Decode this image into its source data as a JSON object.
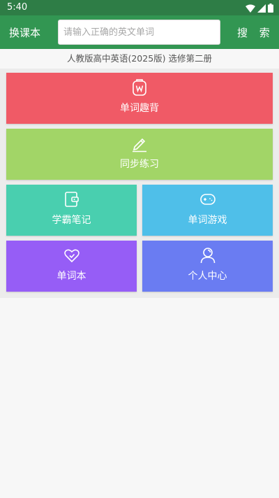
{
  "status_bar": {
    "time": "5:40",
    "icons": [
      "wifi-icon",
      "signal-icon",
      "battery-icon"
    ]
  },
  "app_bar": {
    "change_book_label": "换课本",
    "search_placeholder": "请输入正确的英文单词",
    "search_value": "",
    "search_button_label": "搜 索",
    "color": "#329652"
  },
  "book_title": "人教版高中英语(2025版) 选修第二册",
  "tiles": [
    {
      "label": "单词趣背",
      "icon": "word-card-icon",
      "color": "#f05a66"
    },
    {
      "label": "同步练习",
      "icon": "pencil-icon",
      "color": "#a2d567"
    },
    {
      "label": "学霸笔记",
      "icon": "notebook-icon",
      "color": "#49cfaf"
    },
    {
      "label": "单词游戏",
      "icon": "gamepad-icon",
      "color": "#4fbfe9"
    },
    {
      "label": "单词本",
      "icon": "heart-icon",
      "color": "#965df6"
    },
    {
      "label": "个人中心",
      "icon": "user-icon",
      "color": "#6a7cf2"
    }
  ]
}
